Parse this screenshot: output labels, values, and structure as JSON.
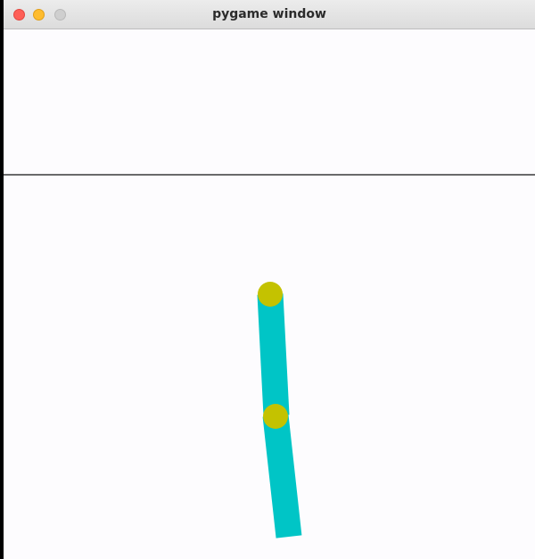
{
  "window": {
    "title": "pygame window"
  },
  "colors": {
    "background": "#fdfcfe",
    "rod": "#00c5c6",
    "joint": "#c4c200",
    "horizon_line": "#3a3a3a"
  }
}
